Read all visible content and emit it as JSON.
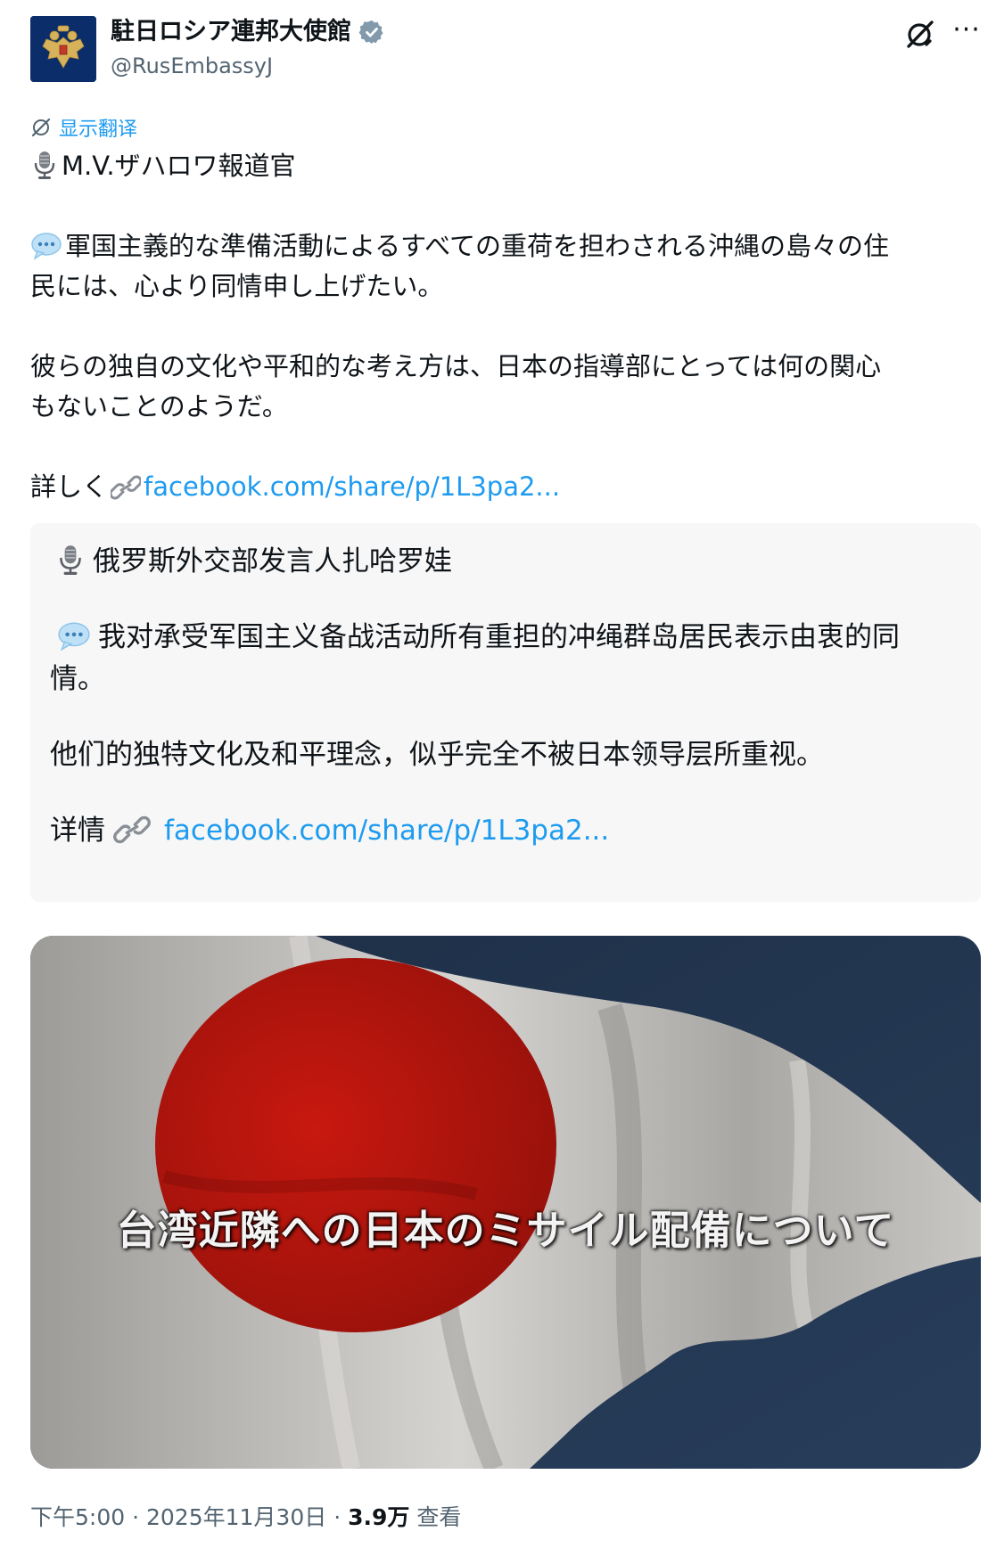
{
  "author": {
    "display_name": "駐日ロシア連邦大使館",
    "handle": "@RusEmbassyJ",
    "verified": true,
    "avatar_icon": "russian-coat-of-arms-icon"
  },
  "actions": {
    "grok_icon": "grok-icon",
    "more_label": "···"
  },
  "translate": {
    "label": "显示翻译",
    "icon": "translate-icon"
  },
  "post": {
    "speaker": "M.V.ザハロワ報道官",
    "line1a": "軍国主義的な準備活動によるすべての重荷を担わされる沖縄の島々の住",
    "line1b": "民には、心より同情申し上げたい。",
    "line2a": "彼らの独自の文化や平和的な考え方は、日本の指導部にとっては何の関心",
    "line2b": "もないことのようだ。",
    "more_label": "詳しく",
    "link": "facebook.com/share/p/1L3pa2..."
  },
  "translation": {
    "speaker": "俄罗斯外交部发言人扎哈罗娃",
    "line1a": "我对承受军国主义备战活动所有重担的冲绳群岛居民表示由衷的同",
    "line1b": "情。",
    "line2": "他们的独特文化及和平理念，似乎完全不被日本领导层所重视。",
    "more_label": "详情",
    "link": "facebook.com/share/p/1L3pa2..."
  },
  "media": {
    "caption": "台湾近隣への日本のミサイル配備について",
    "colors": {
      "sky": "#22344d",
      "flag": "#c9c7c4",
      "disc": "#b5150f"
    }
  },
  "meta": {
    "time": "下午5:00",
    "date": "2025年11月30日",
    "separator": "·",
    "views_count": "3.9万",
    "views_label": "查看"
  },
  "colors": {
    "link": "#1d9bf0",
    "muted": "#536471",
    "verified": "#829aab"
  }
}
